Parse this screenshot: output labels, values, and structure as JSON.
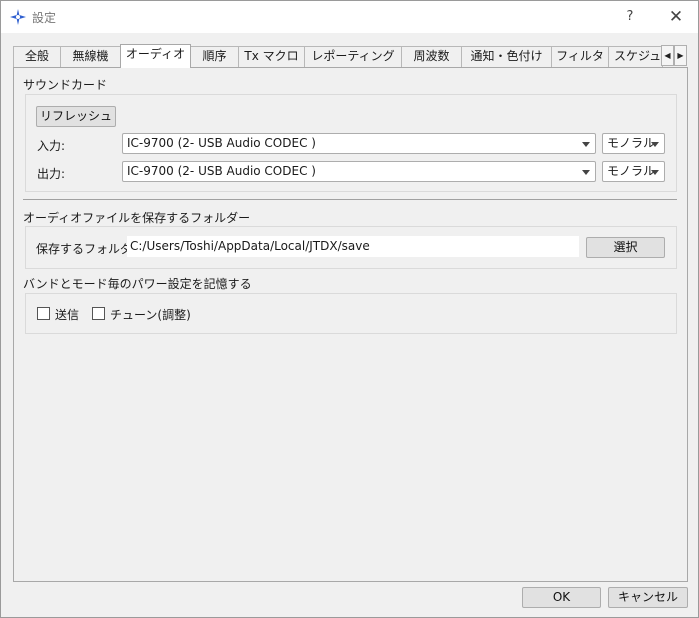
{
  "window": {
    "title": "設定",
    "help_glyph": "?",
    "close_glyph": "✕"
  },
  "tabs": [
    {
      "label": "全般"
    },
    {
      "label": "無線機"
    },
    {
      "label": "オーディオ"
    },
    {
      "label": "順序"
    },
    {
      "label": "Tx マクロ"
    },
    {
      "label": "レポーティング"
    },
    {
      "label": "周波数"
    },
    {
      "label": "通知・色付け"
    },
    {
      "label": "フィルタ"
    },
    {
      "label": "スケジューラ"
    }
  ],
  "active_tab": "オーディオ",
  "tab_scroll": {
    "left": "◀",
    "right": "▶"
  },
  "soundcard": {
    "title": "サウンドカード",
    "refresh_label": "リフレッシュ",
    "input_label": "入力:",
    "input_device": "IC-9700 (2- USB Audio CODEC )",
    "input_mode": "モノラル",
    "output_label": "出力:",
    "output_device": "IC-9700 (2- USB Audio CODEC )",
    "output_mode": "モノラル"
  },
  "save_folder": {
    "title": "オーディオファイルを保存するフォルダー",
    "label": "保存するフォルダー:",
    "path": "C:/Users/Toshi/AppData/Local/JTDX/save",
    "select_label": "選択"
  },
  "power": {
    "title": "バンドとモード毎のパワー設定を記憶する",
    "tx_label": "送信",
    "tx_checked": false,
    "tune_label": "チューン(調整)",
    "tune_checked": false
  },
  "footer": {
    "ok_label": "OK",
    "cancel_label": "キャンセル"
  }
}
